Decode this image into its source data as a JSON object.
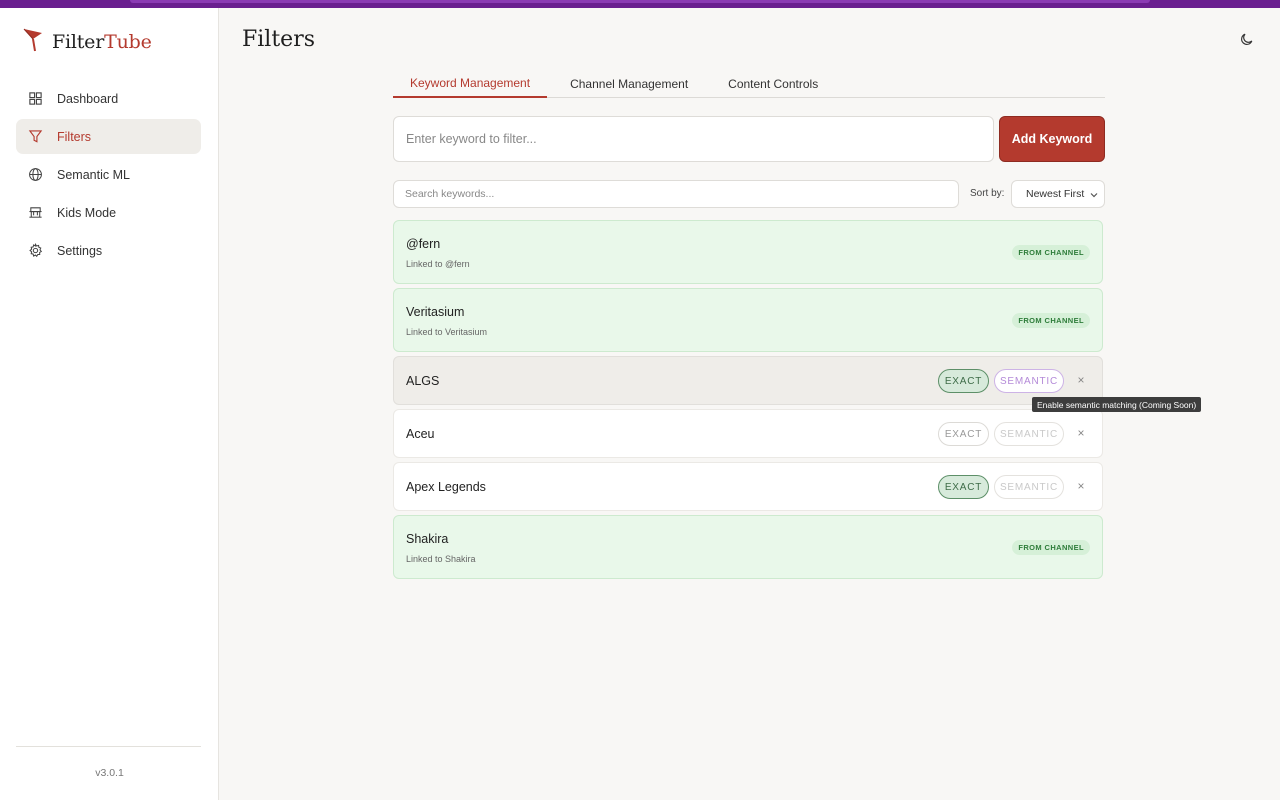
{
  "app": {
    "brand_part1": "Filter",
    "brand_part2": "Tube",
    "version": "v3.0.1",
    "accent_color": "#b43a2e",
    "brand_icon": "filter-tube-logo-icon"
  },
  "sidebar": {
    "items": [
      {
        "label": "Dashboard",
        "icon": "grid-icon",
        "active": false
      },
      {
        "label": "Filters",
        "icon": "filter-icon",
        "active": true
      },
      {
        "label": "Semantic ML",
        "icon": "globe-icon",
        "active": false
      },
      {
        "label": "Kids Mode",
        "icon": "kids-icon",
        "active": false
      },
      {
        "label": "Settings",
        "icon": "gear-icon",
        "active": false
      }
    ]
  },
  "header": {
    "title": "Filters",
    "theme_icon": "moon-icon"
  },
  "tabs": [
    {
      "label": "Keyword Management",
      "active": true
    },
    {
      "label": "Channel Management",
      "active": false
    },
    {
      "label": "Content Controls",
      "active": false
    }
  ],
  "add_form": {
    "placeholder": "Enter keyword to filter...",
    "value": "",
    "button_label": "Add Keyword"
  },
  "search": {
    "placeholder": "Search keywords...",
    "sort_label": "Sort by:",
    "sort_value": "Newest First"
  },
  "keywords": [
    {
      "name": "@fern",
      "type": "channel",
      "sub": "Linked to @fern",
      "badge": "FROM CHANNEL"
    },
    {
      "name": "Veritasium",
      "type": "channel",
      "sub": "Linked to Veritasium",
      "badge": "FROM CHANNEL"
    },
    {
      "name": "ALGS",
      "type": "plain",
      "exact_label": "EXACT",
      "semantic_label": "SEMANTIC",
      "exact_on": true,
      "semantic_hover": true
    },
    {
      "name": "Aceu",
      "type": "plain",
      "exact_label": "EXACT",
      "semantic_label": "SEMANTIC",
      "exact_on": false
    },
    {
      "name": "Apex Legends",
      "type": "plain",
      "exact_label": "EXACT",
      "semantic_label": "SEMANTIC",
      "exact_on": true
    },
    {
      "name": "Shakira",
      "type": "channel",
      "sub": "Linked to Shakira",
      "badge": "FROM CHANNEL"
    }
  ],
  "remove_label": "×",
  "tooltip": "Enable semantic matching (Coming Soon)"
}
